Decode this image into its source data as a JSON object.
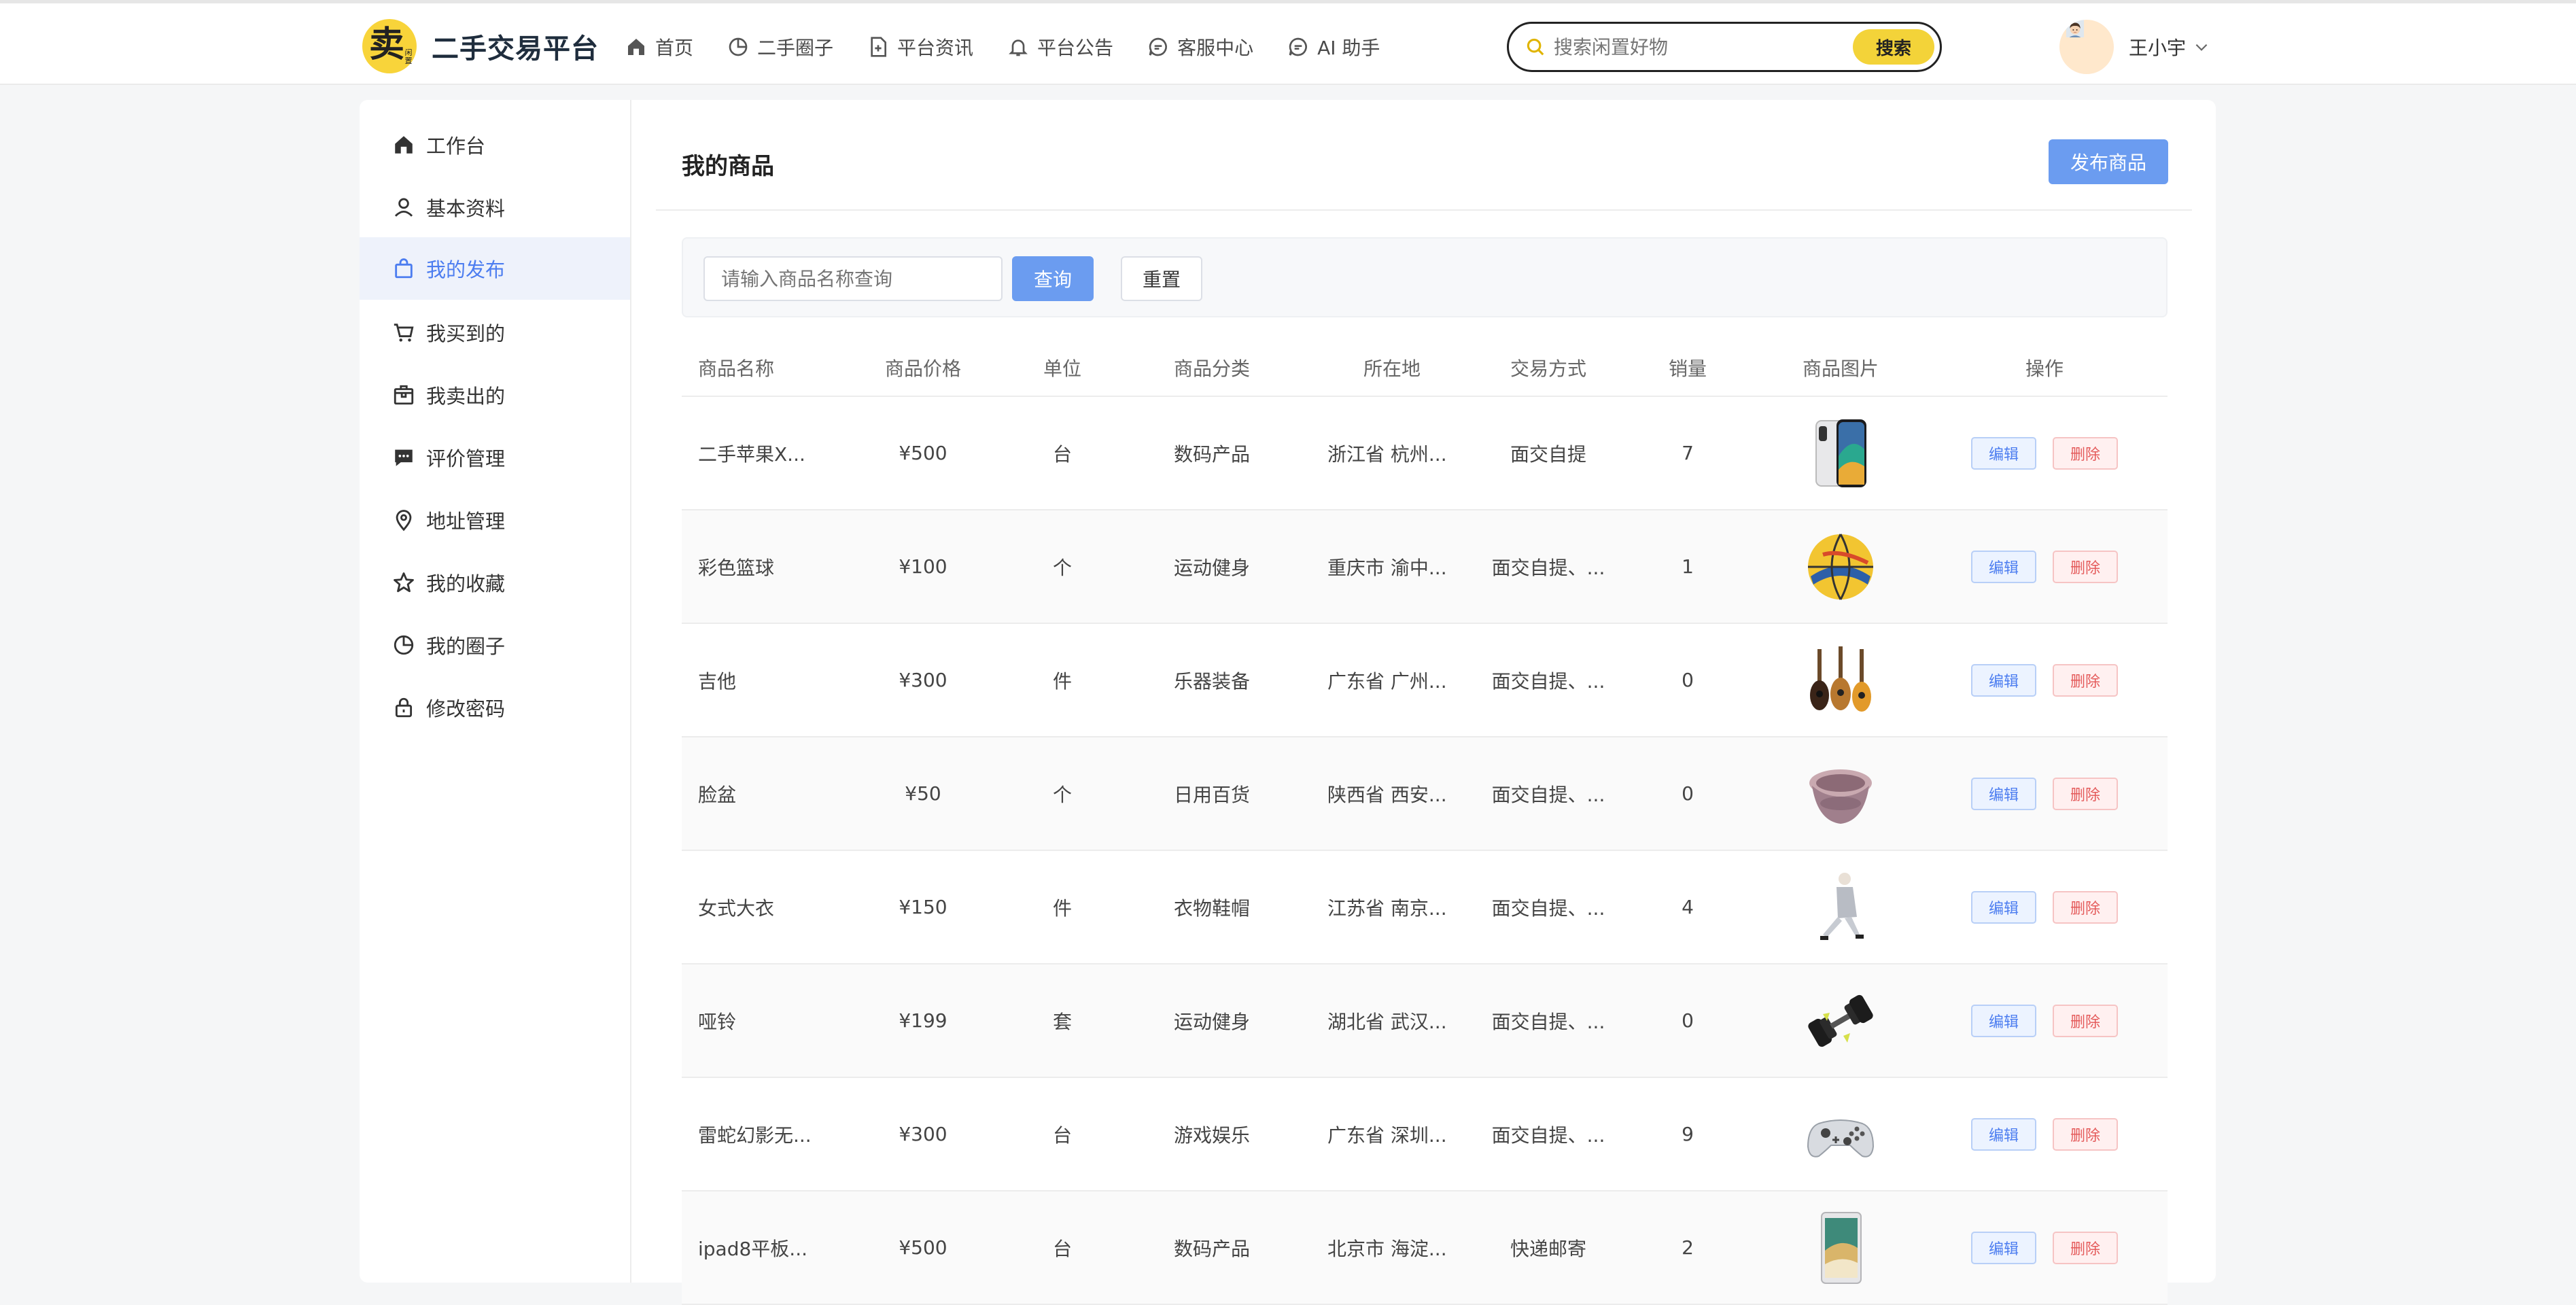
{
  "brand": {
    "logo_big": "卖",
    "logo_small": "闲置",
    "name": "二手交易平台"
  },
  "nav": [
    {
      "label": "首页",
      "icon": "home-icon"
    },
    {
      "label": "二手圈子",
      "icon": "pie-icon"
    },
    {
      "label": "平台资讯",
      "icon": "document-icon"
    },
    {
      "label": "平台公告",
      "icon": "bell-icon"
    },
    {
      "label": "客服中心",
      "icon": "chat-icon"
    },
    {
      "label": "AI 助手",
      "icon": "chat-icon"
    }
  ],
  "search": {
    "placeholder": "搜索闲置好物",
    "button": "搜索"
  },
  "user": {
    "name": "王小宇"
  },
  "sidebar": [
    {
      "label": "工作台",
      "icon": "home-icon",
      "active": false
    },
    {
      "label": "基本资料",
      "icon": "user-icon",
      "active": false
    },
    {
      "label": "我的发布",
      "icon": "bag-icon",
      "active": true
    },
    {
      "label": "我买到的",
      "icon": "cart-icon",
      "active": false
    },
    {
      "label": "我卖出的",
      "icon": "box-icon",
      "active": false
    },
    {
      "label": "评价管理",
      "icon": "comment-icon",
      "active": false
    },
    {
      "label": "地址管理",
      "icon": "location-icon",
      "active": false
    },
    {
      "label": "我的收藏",
      "icon": "star-icon",
      "active": false
    },
    {
      "label": "我的圈子",
      "icon": "pie-icon",
      "active": false
    },
    {
      "label": "修改密码",
      "icon": "lock-icon",
      "active": false
    }
  ],
  "main": {
    "title": "我的商品",
    "publish_button": "发布商品",
    "filter": {
      "placeholder": "请输入商品名称查询",
      "query_button": "查询",
      "reset_button": "重置"
    },
    "columns": [
      "商品名称",
      "商品价格",
      "单位",
      "商品分类",
      "所在地",
      "交易方式",
      "销量",
      "商品图片",
      "操作"
    ],
    "rows": [
      {
        "name": "二手苹果X...",
        "price": "¥500",
        "unit": "台",
        "category": "数码产品",
        "location": "浙江省 杭州...",
        "trade": "面交自提",
        "sales": "7",
        "image": "iphone-image"
      },
      {
        "name": "彩色篮球",
        "price": "¥100",
        "unit": "个",
        "category": "运动健身",
        "location": "重庆市 渝中...",
        "trade": "面交自提、...",
        "sales": "1",
        "image": "basketball-image"
      },
      {
        "name": "吉他",
        "price": "¥300",
        "unit": "件",
        "category": "乐器装备",
        "location": "广东省 广州...",
        "trade": "面交自提、...",
        "sales": "0",
        "image": "guitar-image"
      },
      {
        "name": "脸盆",
        "price": "¥50",
        "unit": "个",
        "category": "日用百货",
        "location": "陕西省 西安...",
        "trade": "面交自提、...",
        "sales": "0",
        "image": "basin-image"
      },
      {
        "name": "女式大衣",
        "price": "¥150",
        "unit": "件",
        "category": "衣物鞋帽",
        "location": "江苏省 南京...",
        "trade": "面交自提、...",
        "sales": "4",
        "image": "coat-image"
      },
      {
        "name": "哑铃",
        "price": "¥199",
        "unit": "套",
        "category": "运动健身",
        "location": "湖北省 武汉...",
        "trade": "面交自提、...",
        "sales": "0",
        "image": "dumbbell-image"
      },
      {
        "name": "雷蛇幻影无...",
        "price": "¥300",
        "unit": "台",
        "category": "游戏娱乐",
        "location": "广东省 深圳...",
        "trade": "面交自提、...",
        "sales": "9",
        "image": "gamepad-image"
      },
      {
        "name": "ipad8平板...",
        "price": "¥500",
        "unit": "台",
        "category": "数码产品",
        "location": "北京市 海淀...",
        "trade": "快递邮寄",
        "sales": "2",
        "image": "ipad-image"
      }
    ],
    "edit_label": "编辑",
    "delete_label": "删除"
  },
  "colors": {
    "accent": "#6b9cf0",
    "brand_yellow": "#f8d43a",
    "danger": "#e45a5a",
    "active_bg": "#eef2fb"
  }
}
